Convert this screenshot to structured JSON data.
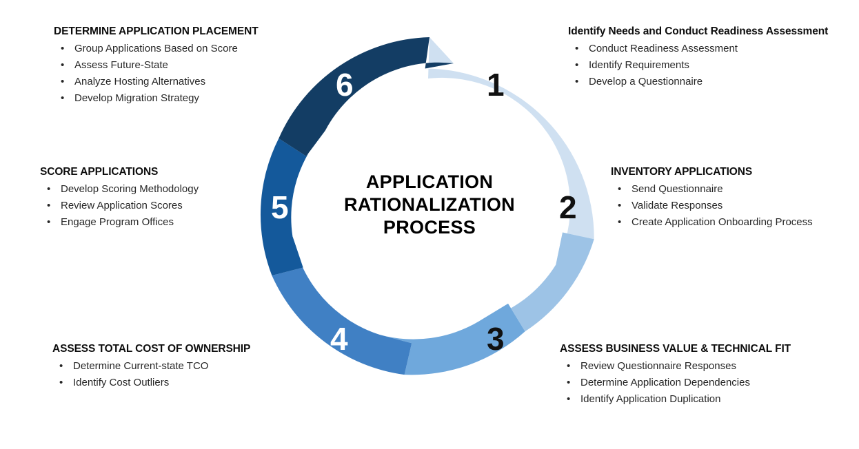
{
  "center": {
    "line1": "APPLICATION",
    "line2": "RATIONALIZATION",
    "line3": "PROCESS"
  },
  "colors": {
    "step1": "#cfe0f1",
    "step2": "#9dc3e6",
    "step3": "#6fa8dc",
    "step4": "#4080c4",
    "step5": "#14599b",
    "step6": "#133d64",
    "gap": "#ffffff",
    "number_dark": "#111111",
    "number_light": "#ffffff",
    "heading": "#0d0d0d",
    "body_text": "#262626"
  },
  "chart_data": {
    "type": "pie",
    "title": "APPLICATION RATIONALIZATION PROCESS",
    "categories": [
      "1",
      "2",
      "3",
      "4",
      "5",
      "6"
    ],
    "values": [
      1,
      1,
      1,
      1,
      1,
      1
    ],
    "legend_position": "around"
  },
  "steps": [
    {
      "number": "1",
      "number_color": "number_dark",
      "color": "#cfe0f1",
      "heading": "Identify Needs and Conduct Readiness Assessment",
      "heading_case": "title",
      "bullets": [
        "Conduct Readiness Assessment",
        "Identify Requirements",
        "Develop a Questionnaire"
      ]
    },
    {
      "number": "2",
      "number_color": "number_dark",
      "color": "#9dc3e6",
      "heading": "INVENTORY APPLICATIONS",
      "heading_case": "upper",
      "bullets": [
        "Send Questionnaire",
        "Validate Responses",
        "Create Application Onboarding Process"
      ]
    },
    {
      "number": "3",
      "number_color": "number_dark",
      "color": "#6fa8dc",
      "heading": "ASSESS BUSINESS VALUE & TECHNICAL FIT",
      "heading_case": "upper",
      "bullets": [
        "Review Questionnaire Responses",
        "Determine Application Dependencies",
        "Identify Application Duplication"
      ]
    },
    {
      "number": "4",
      "number_color": "number_light",
      "color": "#4080c4",
      "heading": "ASSESS TOTAL COST OF OWNERSHIP",
      "heading_case": "upper",
      "bullets": [
        "Determine Current-state TCO",
        "Identify  Cost Outliers"
      ]
    },
    {
      "number": "5",
      "number_color": "number_light",
      "color": "#14599b",
      "heading": "SCORE APPLICATIONS",
      "heading_case": "upper",
      "bullets": [
        "Develop Scoring Methodology",
        "Review Application Scores",
        "Engage Program Offices"
      ]
    },
    {
      "number": "6",
      "number_color": "number_light",
      "color": "#133d64",
      "heading": "DETERMINE APPLICATION PLACEMENT",
      "heading_case": "upper",
      "bullets": [
        "Group Applications Based on Score",
        "Assess Future-State",
        "Analyze Hosting Alternatives",
        "Develop Migration Strategy"
      ]
    }
  ],
  "bullet_glyph": "•"
}
